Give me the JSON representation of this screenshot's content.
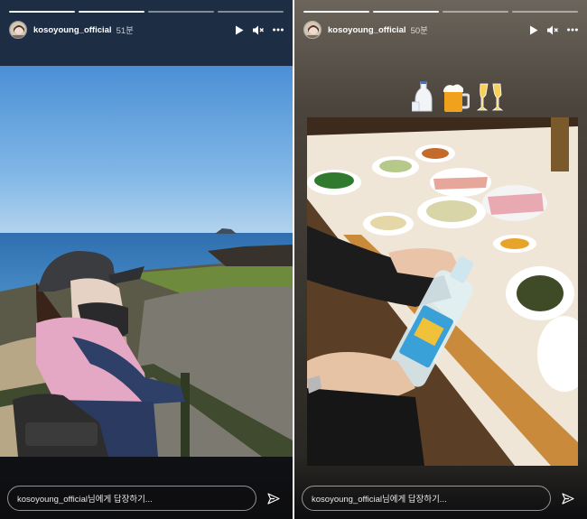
{
  "stories": [
    {
      "username": "kosoyoung_official",
      "time": "51분",
      "reply_placeholder": "kosoyoung_official님에게 답장하기..."
    },
    {
      "username": "kosoyoung_official",
      "time": "50분",
      "reply_placeholder": "kosoyoung_official님에게 답장하기..."
    }
  ],
  "icons": [
    "play-icon",
    "mute-icon",
    "more-icon",
    "send-icon"
  ],
  "colors": {
    "text": "#ffffff",
    "progress_done": "#ffffff"
  }
}
